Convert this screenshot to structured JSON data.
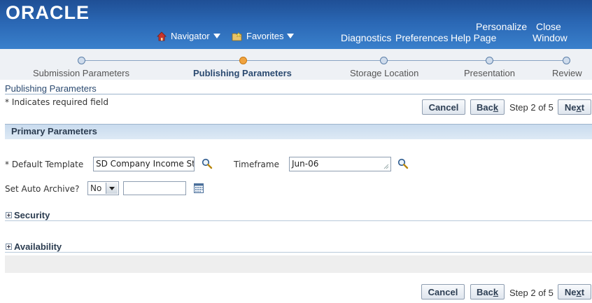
{
  "header": {
    "logo": "ORACLE",
    "navigator": "Navigator",
    "favorites": "Favorites",
    "diagnostics": "Diagnostics",
    "preferences": "Preferences",
    "personalize_line1": "Personalize",
    "personalize_line2": "Help Page",
    "close_line1": "Close",
    "close_line2": "Window"
  },
  "train": {
    "steps": [
      {
        "label": "Submission Parameters"
      },
      {
        "label": "Publishing Parameters"
      },
      {
        "label": "Storage Location"
      },
      {
        "label": "Presentation"
      },
      {
        "label": "Review"
      }
    ],
    "active_index": 1
  },
  "page": {
    "title": "Publishing Parameters",
    "required_note": "* Indicates required field"
  },
  "buttons": {
    "cancel": "Cancel",
    "back_pre": "Bac",
    "back_key": "k",
    "next_pre": "Ne",
    "next_key": "x",
    "next_post": "t",
    "step_text": "Step 2 of 5"
  },
  "region": {
    "title": "Primary Parameters",
    "default_template_label": "* Default Template",
    "default_template_value": "SD Company Income Sta",
    "timeframe_label": "Timeframe",
    "timeframe_value": "Jun-06",
    "auto_archive_label": "Set Auto Archive?",
    "auto_archive_value": "No",
    "auto_archive_date": "",
    "security": "Security",
    "availability": "Availability"
  },
  "colors": {
    "header_blue": "#2a67b4",
    "active_step": "#f0a33f",
    "title_blue": "#2b4a70"
  }
}
